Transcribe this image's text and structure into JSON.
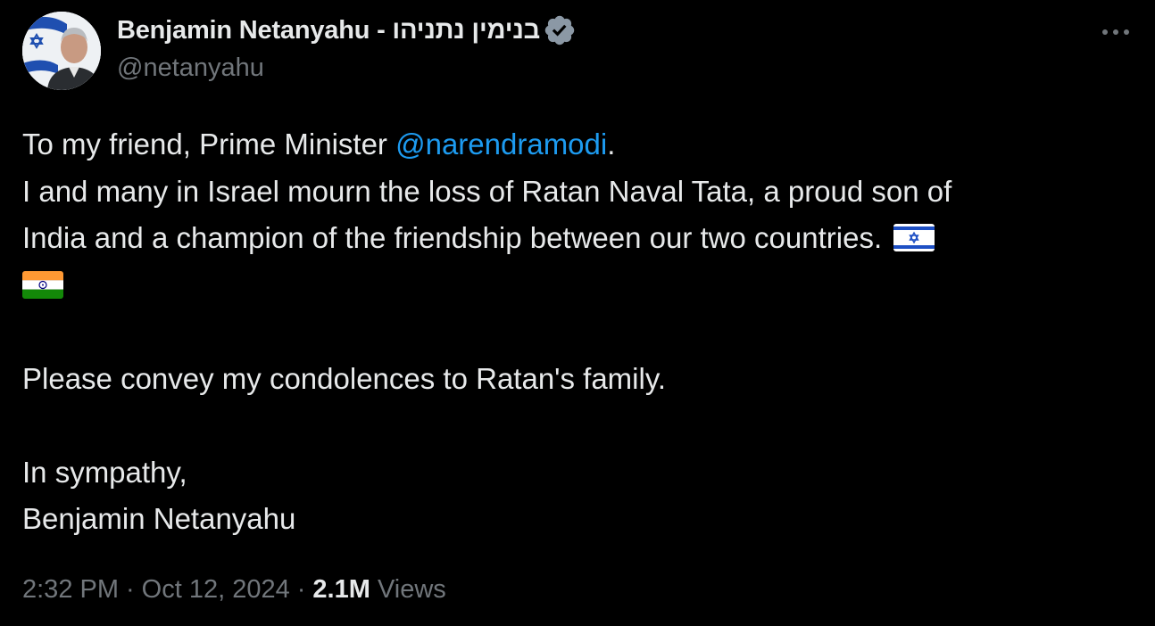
{
  "author": {
    "display_name": "Benjamin Netanyahu - בנימין נתניהו",
    "handle": "@netanyahu",
    "verified": true,
    "verified_color": "#8b98a5"
  },
  "tweet": {
    "line1_prefix": "To my friend, Prime Minister ",
    "mention": "@narendramodi",
    "line1_suffix": ".",
    "line2": "I and many in Israel mourn the loss of Ratan Naval Tata, a proud son of",
    "line3": "India and a champion of the friendship between our two countries.",
    "flags": [
      "israel-flag",
      "india-flag"
    ],
    "line5": "Please convey my condolences to Ratan's family.",
    "line7": "In sympathy,",
    "line8": "Benjamin Netanyahu"
  },
  "meta": {
    "time": "2:32 PM",
    "date": "Oct 12, 2024",
    "views_count": "2.1M",
    "views_label": "Views",
    "separator": "·"
  },
  "colors": {
    "background": "#000000",
    "text": "#e7e9ea",
    "secondary": "#71767b",
    "link": "#1d9bf0"
  }
}
